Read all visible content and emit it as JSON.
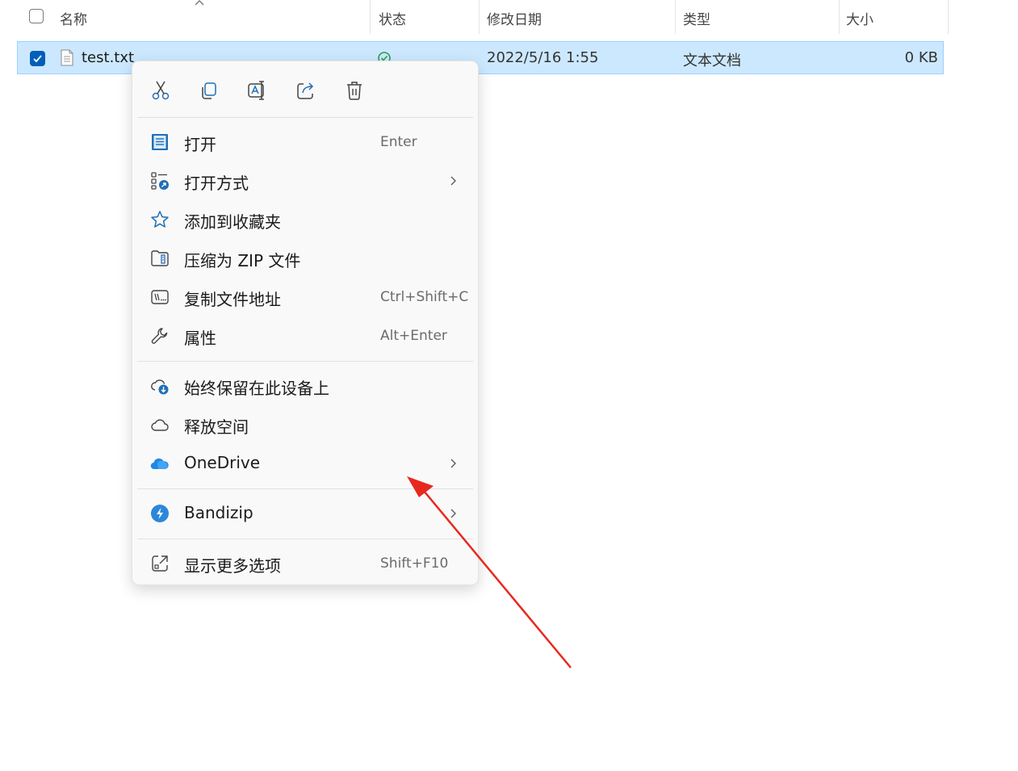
{
  "header": {
    "col_name": "名称",
    "col_status": "状态",
    "col_modified": "修改日期",
    "col_type": "类型",
    "col_size": "大小"
  },
  "file": {
    "name": "test.txt",
    "modified": "2022/5/16 1:55",
    "type": "文本文档",
    "size": "0 KB",
    "selected": true,
    "status_icon": "sync-ok-icon"
  },
  "context_menu": {
    "toolbar": [
      "cut-icon",
      "copy-icon",
      "rename-icon",
      "share-icon",
      "delete-icon"
    ],
    "items": [
      {
        "label": "打开",
        "shortcut": "Enter",
        "icon": "notepad-icon"
      },
      {
        "label": "打开方式",
        "shortcut": "",
        "icon": "open-with-icon",
        "submenu": true
      },
      {
        "label": "添加到收藏夹",
        "shortcut": "",
        "icon": "star-icon"
      },
      {
        "label": "压缩为 ZIP 文件",
        "shortcut": "",
        "icon": "zip-folder-icon"
      },
      {
        "label": "复制文件地址",
        "shortcut": "Ctrl+Shift+C",
        "icon": "copy-path-icon"
      },
      {
        "label": "属性",
        "shortcut": "Alt+Enter",
        "icon": "wrench-icon"
      },
      {
        "label": "始终保留在此设备上",
        "shortcut": "",
        "icon": "cloud-download-icon"
      },
      {
        "label": "释放空间",
        "shortcut": "",
        "icon": "cloud-icon"
      },
      {
        "label": "OneDrive",
        "shortcut": "",
        "icon": "onedrive-icon",
        "submenu": true
      },
      {
        "label": "Bandizip",
        "shortcut": "",
        "icon": "bandizip-icon",
        "submenu": true
      },
      {
        "label": "显示更多选项",
        "shortcut": "Shift+F10",
        "icon": "show-more-icon"
      }
    ]
  },
  "colors": {
    "selection_bg": "#cce8ff",
    "selection_border": "#99d1ff",
    "checkbox_checked": "#005fb8",
    "icon_blue": "#1f6fb5",
    "annotation_arrow": "#e8281e"
  }
}
